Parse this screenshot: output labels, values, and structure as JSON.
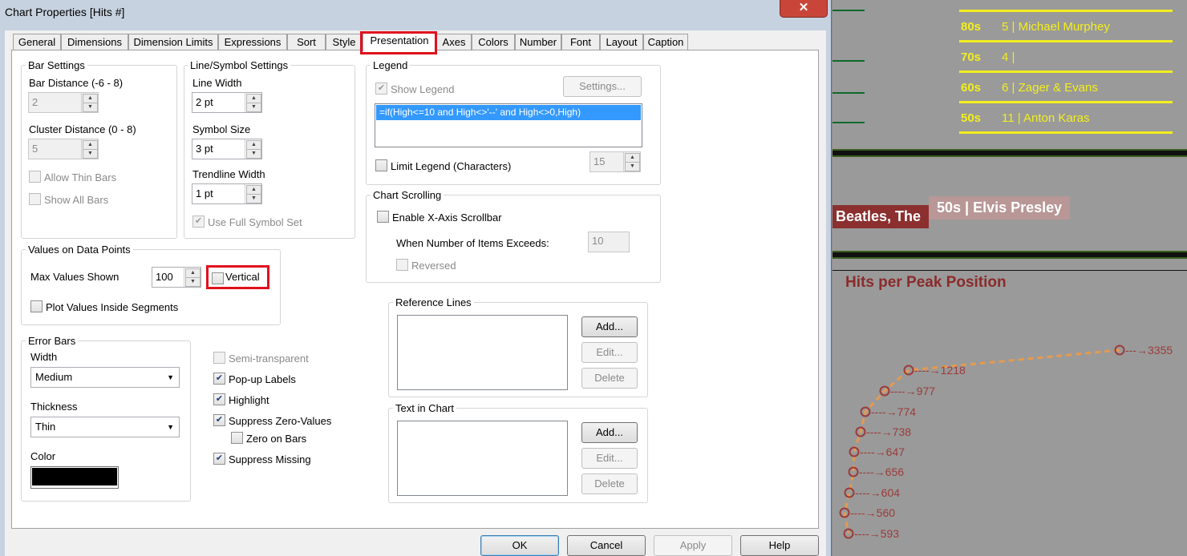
{
  "window": {
    "title": "Chart Properties [Hits #]",
    "close_label": "✕"
  },
  "tabs": [
    "General",
    "Dimensions",
    "Dimension Limits",
    "Expressions",
    "Sort",
    "Style",
    "Presentation",
    "Axes",
    "Colors",
    "Number",
    "Font",
    "Layout",
    "Caption"
  ],
  "active_tab": "Presentation",
  "bar_settings": {
    "title": "Bar Settings",
    "bar_distance_label": "Bar Distance (-6 - 8)",
    "bar_distance_value": "2",
    "cluster_distance_label": "Cluster Distance (0 - 8)",
    "cluster_distance_value": "5",
    "allow_thin_bars": "Allow Thin Bars",
    "show_all_bars": "Show All Bars"
  },
  "line_settings": {
    "title": "Line/Symbol Settings",
    "line_width_label": "Line Width",
    "line_width_value": "2 pt",
    "symbol_size_label": "Symbol Size",
    "symbol_size_value": "3 pt",
    "trendline_width_label": "Trendline Width",
    "trendline_width_value": "1 pt",
    "use_full_symbol_set": "Use Full Symbol Set",
    "use_full_symbol_set_checked": true
  },
  "values_on_points": {
    "title": "Values on Data Points",
    "max_values_label": "Max Values Shown",
    "max_values_value": "100",
    "vertical_label": "Vertical",
    "vertical_checked": false,
    "plot_inside_label": "Plot Values Inside Segments",
    "plot_inside_checked": false
  },
  "error_bars": {
    "title": "Error Bars",
    "width_label": "Width",
    "width_value": "Medium",
    "thickness_label": "Thickness",
    "thickness_value": "Thin",
    "color_label": "Color",
    "color_value": "#000000"
  },
  "options": {
    "semi_transparent": "Semi-transparent",
    "popup_labels": "Pop-up Labels",
    "highlight": "Highlight",
    "suppress_zero": "Suppress Zero-Values",
    "zero_on_bars": "Zero on Bars",
    "suppress_missing": "Suppress Missing"
  },
  "legend": {
    "title": "Legend",
    "show_legend": "Show Legend",
    "settings_button": "Settings...",
    "expression": "=if(High<=10 and High<>'--' and High<>0,High)",
    "limit_label": "Limit Legend (Characters)",
    "limit_value": "15"
  },
  "chart_scrolling": {
    "title": "Chart Scrolling",
    "enable_label": "Enable X-Axis Scrollbar",
    "items_label": "When Number of Items Exceeds:",
    "items_value": "10",
    "reversed_label": "Reversed"
  },
  "reference_lines": {
    "title": "Reference Lines",
    "add": "Add...",
    "edit": "Edit...",
    "delete": "Delete"
  },
  "text_in_chart": {
    "title": "Text in Chart",
    "add": "Add...",
    "edit": "Edit...",
    "delete": "Delete"
  },
  "footer": {
    "ok": "OK",
    "cancel": "Cancel",
    "apply": "Apply",
    "help": "Help"
  },
  "background": {
    "rows": [
      {
        "decade": "80s",
        "text": "5 | Michael Murphey"
      },
      {
        "decade": "70s",
        "text": "4 |"
      },
      {
        "decade": "60s",
        "text": "6 | Zager & Evans"
      },
      {
        "decade": "50s",
        "text": "11 | Anton Karas"
      }
    ],
    "tag_left": "Beatles, The",
    "tag_right": "50s | Elvis Presley",
    "chart_title": "Hits per Peak Position",
    "point_labels": [
      "3355",
      "1218",
      "977",
      "774",
      "738",
      "647",
      "656",
      "604",
      "560",
      "593"
    ]
  }
}
